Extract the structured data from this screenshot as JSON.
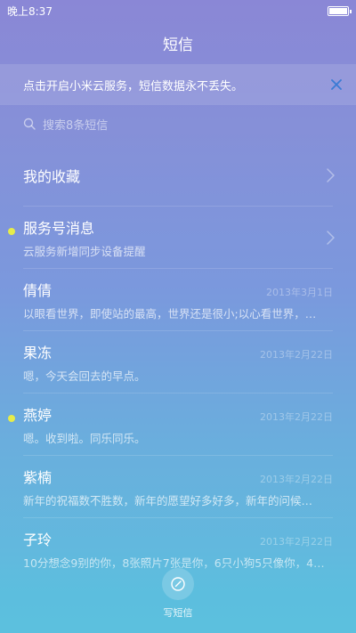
{
  "status_bar": {
    "time": "晚上8:37",
    "battery_level": 1.0
  },
  "header": {
    "title": "短信"
  },
  "banner": {
    "text": "点击开启小米云服务，短信数据永不丢失。",
    "close_icon": "close-icon"
  },
  "search": {
    "placeholder": "搜索8条短信",
    "icon": "search-icon"
  },
  "conversations": [
    {
      "name": "我的收藏",
      "preview": "",
      "date": "",
      "unread": false,
      "chevron": true
    },
    {
      "name": "服务号消息",
      "preview": "云服务新增同步设备提醒",
      "date": "",
      "unread": true,
      "chevron": true
    },
    {
      "name": "倩倩",
      "preview": "以眼看世界，即使站的最高，世界还是很小;以心看世界，…",
      "date": "2013年3月1日",
      "unread": false,
      "chevron": false
    },
    {
      "name": "果冻",
      "preview": "嗯，今天会回去的早点。",
      "date": "2013年2月22日",
      "unread": false,
      "chevron": false
    },
    {
      "name": "燕婷",
      "preview": "嗯。收到啦。同乐同乐。",
      "date": "2013年2月22日",
      "unread": true,
      "chevron": false
    },
    {
      "name": "紫楠",
      "preview": "新年的祝福数不胜数，新年的愿望好多好多，新年的问候…",
      "date": "2013年2月22日",
      "unread": false,
      "chevron": false
    },
    {
      "name": "子玲",
      "preview": "10分想念9别的你，8张照片7张是你，6只小狗5只像你，4…",
      "date": "2013年2月22日",
      "unread": false,
      "chevron": false
    }
  ],
  "compose": {
    "label": "写短信",
    "icon": "compose-icon"
  },
  "colors": {
    "unread_dot": "#e6ec4a",
    "close_icon": "#3a7bd5"
  }
}
